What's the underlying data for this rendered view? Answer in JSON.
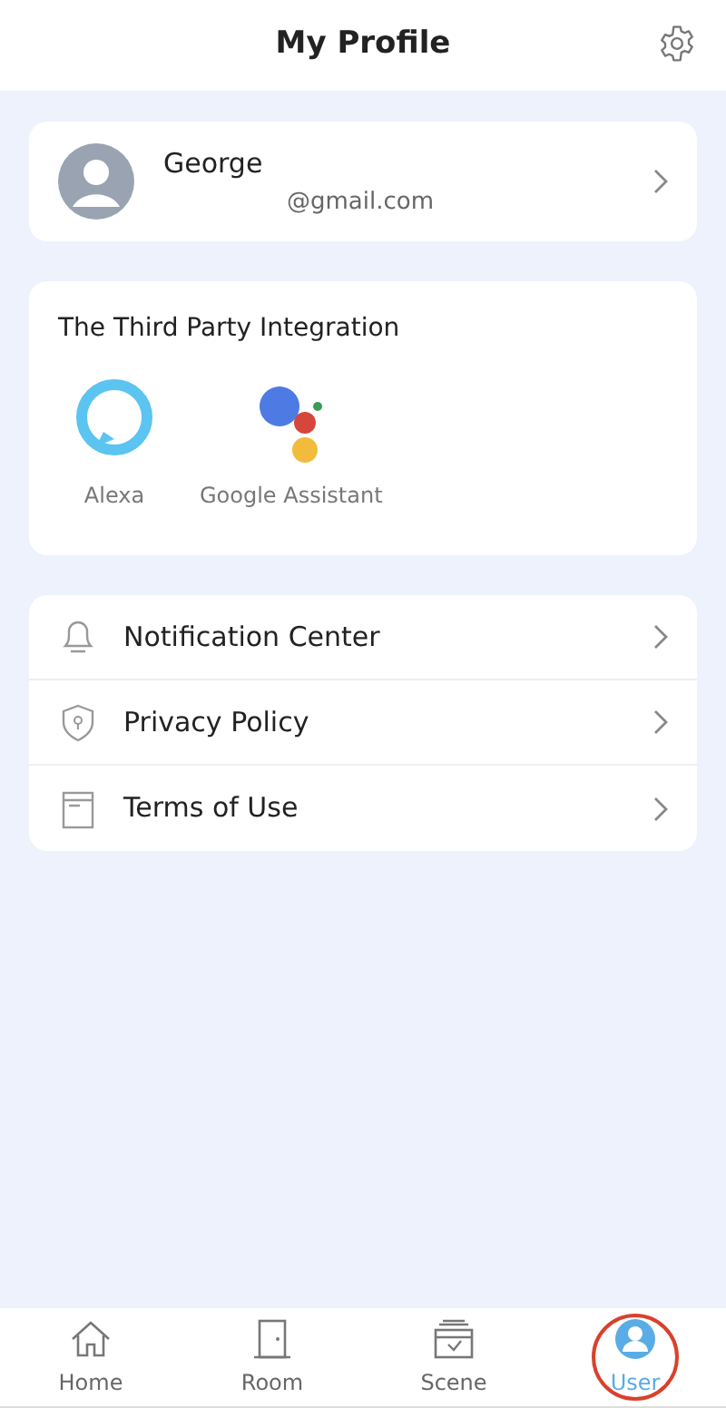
{
  "header": {
    "title": "My Profile"
  },
  "profile": {
    "name": "George",
    "email": "@gmail.com"
  },
  "integration": {
    "title": "The Third Party Integration",
    "services": [
      {
        "kind": "alexa",
        "label": "Alexa"
      },
      {
        "kind": "google",
        "label": "Google Assistant"
      }
    ]
  },
  "menu": [
    {
      "kind": "bell",
      "label": "Notification Center"
    },
    {
      "kind": "shield",
      "label": "Privacy Policy"
    },
    {
      "kind": "document",
      "label": "Terms of Use"
    }
  ],
  "tabs": [
    {
      "kind": "home",
      "label": "Home",
      "selected": false,
      "circled": false
    },
    {
      "kind": "door",
      "label": "Room",
      "selected": false,
      "circled": false
    },
    {
      "kind": "scene",
      "label": "Scene",
      "selected": false,
      "circled": false
    },
    {
      "kind": "user",
      "label": "User",
      "selected": true,
      "circled": true
    }
  ]
}
